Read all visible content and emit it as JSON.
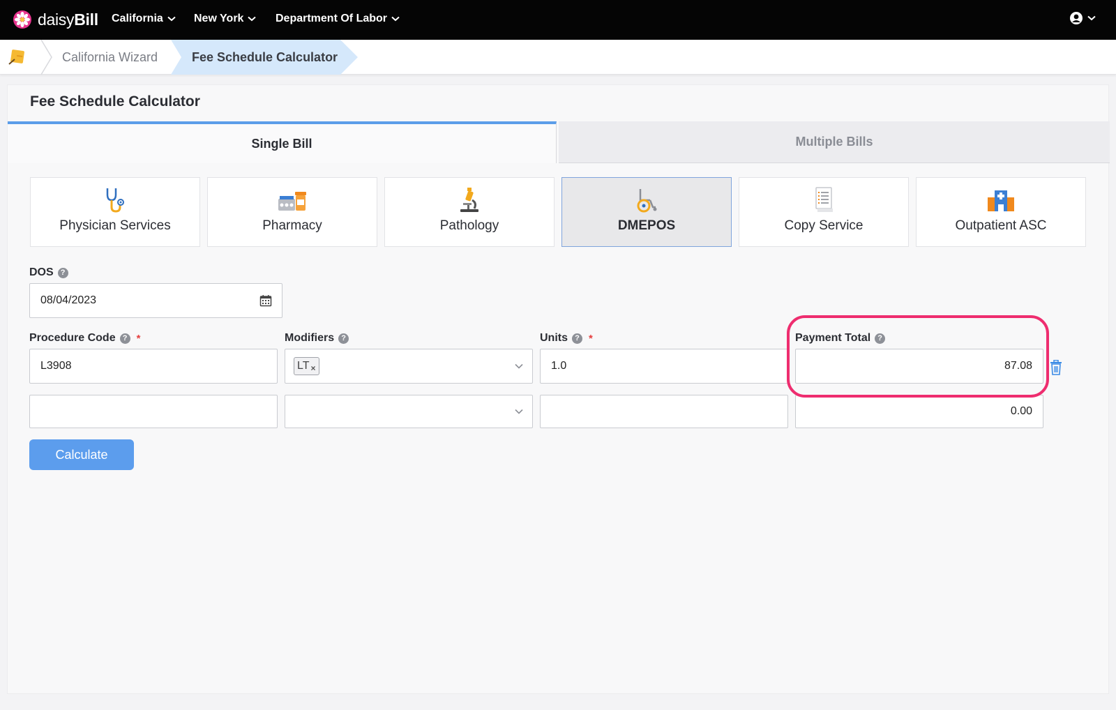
{
  "app": {
    "brand_light": "daisy",
    "brand_bold": "Bill",
    "menus": [
      "California",
      "New York",
      "Department Of Labor"
    ]
  },
  "breadcrumb": {
    "items": [
      "California Wizard",
      "Fee Schedule Calculator"
    ]
  },
  "page": {
    "title": "Fee Schedule Calculator",
    "tabs": [
      {
        "label": "Single Bill",
        "active": true
      },
      {
        "label": "Multiple Bills",
        "active": false
      }
    ],
    "services": [
      {
        "label": "Physician Services",
        "icon": "stethoscope-icon"
      },
      {
        "label": "Pharmacy",
        "icon": "pharmacy-icon"
      },
      {
        "label": "Pathology",
        "icon": "microscope-icon"
      },
      {
        "label": "DMEPOS",
        "icon": "wheelchair-icon",
        "active": true
      },
      {
        "label": "Copy Service",
        "icon": "document-icon"
      },
      {
        "label": "Outpatient ASC",
        "icon": "hospital-icon"
      }
    ]
  },
  "form": {
    "dos_label": "DOS",
    "dos_value": "08/04/2023",
    "procedure_label": "Procedure Code",
    "modifiers_label": "Modifiers",
    "units_label": "Units",
    "payment_label": "Payment Total",
    "required_mark": "*",
    "help_mark": "?",
    "rows": [
      {
        "procedure": "L3908",
        "modifier": "LT",
        "units": "1.0",
        "payment": "87.08"
      },
      {
        "procedure": "",
        "modifier": "",
        "units": "",
        "payment": "0.00"
      }
    ],
    "calculate_label": "Calculate",
    "tag_remove": "×"
  },
  "colors": {
    "accent": "#5c9ded",
    "highlight": "#ee2d6f",
    "nav_bg": "#050505"
  }
}
